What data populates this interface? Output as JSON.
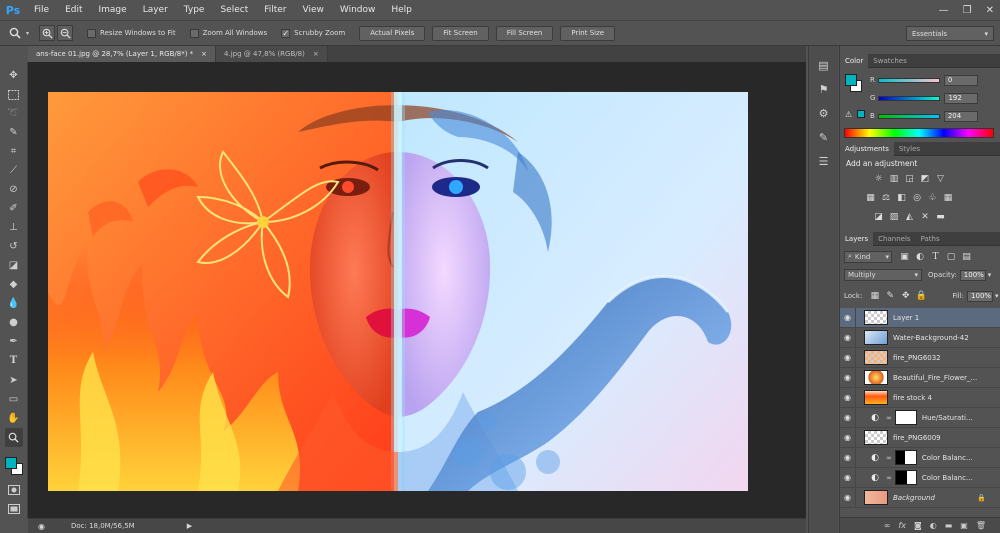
{
  "app": {
    "logo": "Ps"
  },
  "menu": [
    "File",
    "Edit",
    "Image",
    "Layer",
    "Type",
    "Select",
    "Filter",
    "View",
    "Window",
    "Help"
  ],
  "window_controls": {
    "minimize": "—",
    "restore": "❐",
    "close": "✕"
  },
  "options_bar": {
    "resize_windows": "Resize Windows to Fit",
    "zoom_all": "Zoom All Windows",
    "scrubby_zoom": "Scrubby Zoom",
    "actual_pixels": "Actual Pixels",
    "fit_screen": "Fit Screen",
    "fill_screen": "Fill Screen",
    "print_size": "Print Size",
    "workspace": "Essentials"
  },
  "tabs": [
    {
      "label": "ans-face 01.jpg @ 28,7% (Layer 1, RGB/8*) *",
      "close": "×"
    },
    {
      "label": "4.jpg @ 47,8% (RGB/8)",
      "close": "×"
    }
  ],
  "status": {
    "doc": "Doc: 18,0M/56,5M"
  },
  "colors": {
    "foreground": "#00b4bf",
    "background": "#ffffff",
    "panel_bg": "#535353",
    "accent_selected": "#5c6a80"
  },
  "color_panel": {
    "tabs": [
      "Color",
      "Swatches"
    ],
    "r_label": "R",
    "g_label": "G",
    "b_label": "B",
    "r": "0",
    "g": "192",
    "b": "204"
  },
  "adjustments_panel": {
    "tabs": [
      "Adjustments",
      "Styles"
    ],
    "heading": "Add an adjustment"
  },
  "layers_panel": {
    "tabs": [
      "Layers",
      "Channels",
      "Paths"
    ],
    "kind": "Kind",
    "blend_mode": "Multiply",
    "opacity_label": "Opacity:",
    "opacity": "100%",
    "lock_label": "Lock:",
    "fill_label": "Fill:",
    "fill": "100%",
    "layers": [
      {
        "name": "Layer 1",
        "thumb": "checker",
        "selected": true
      },
      {
        "name": "Water-Background-42",
        "thumb": "water"
      },
      {
        "name": "fire_PNG6032",
        "thumb": "checker-fire"
      },
      {
        "name": "Beautiful_Fire_Flower_...",
        "thumb": "flower"
      },
      {
        "name": "fire stock 4",
        "thumb": "fire"
      },
      {
        "name": "Hue/Saturati...",
        "adjustment": true,
        "mask": "white"
      },
      {
        "name": "fire_PNG6009",
        "thumb": "checker-fire"
      },
      {
        "name": "Color Balanc...",
        "adjustment": true,
        "mask": "bw"
      },
      {
        "name": "Color Balanc...",
        "adjustment": true,
        "mask": "bw"
      },
      {
        "name": "Background",
        "thumb": "face",
        "locked": true
      }
    ]
  }
}
